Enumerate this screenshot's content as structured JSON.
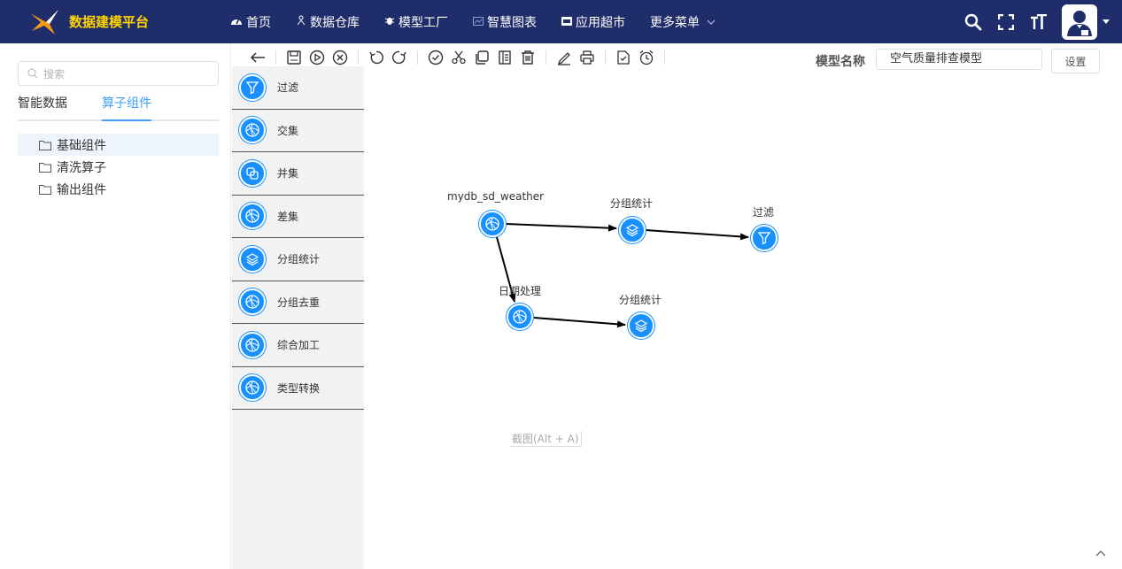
{
  "app": {
    "title": "数据建模平台"
  },
  "nav": [
    {
      "icon": "dashboard-icon",
      "label": "首页"
    },
    {
      "icon": "user-tree-icon",
      "label": "数据仓库"
    },
    {
      "icon": "bug-icon",
      "label": "模型工厂"
    },
    {
      "icon": "chart-card-icon",
      "label": "智慧图表"
    },
    {
      "icon": "store-icon",
      "label": "应用超市"
    },
    {
      "icon": "",
      "label": "更多菜单"
    }
  ],
  "left": {
    "search_placeholder": "搜索",
    "tabs": [
      {
        "label": "智能数据"
      },
      {
        "label": "算子组件",
        "active": true
      }
    ],
    "tree": [
      {
        "label": "基础组件",
        "selected": true
      },
      {
        "label": "清洗算子"
      },
      {
        "label": "输出组件"
      }
    ]
  },
  "toolbar": {
    "model_name_label": "模型名称",
    "model_name_value": "空气质量排查模型",
    "settings_label": "设置",
    "buttons": [
      "back-arrow-icon",
      "save-icon",
      "play-icon",
      "stop-icon",
      "undo-icon",
      "redo-icon",
      "check-icon",
      "cut-icon",
      "copy-icon",
      "document-icon",
      "delete-icon",
      "edit-icon",
      "print-icon",
      "export-icon",
      "alarm-icon"
    ]
  },
  "palette": [
    {
      "icon": "filter-icon",
      "label": "过滤"
    },
    {
      "icon": "globe-icon",
      "label": "交集"
    },
    {
      "icon": "union-icon",
      "label": "并集"
    },
    {
      "icon": "globe-icon",
      "label": "差集"
    },
    {
      "icon": "layers-icon",
      "label": "分组统计"
    },
    {
      "icon": "globe-icon",
      "label": "分组去重"
    },
    {
      "icon": "globe-icon",
      "label": "综合加工"
    },
    {
      "icon": "globe-icon",
      "label": "类型转换"
    }
  ],
  "canvas": {
    "nodes": [
      {
        "id": "n1",
        "label": "mydb_sd_weather",
        "icon": "globe-icon"
      },
      {
        "id": "n2",
        "label": "分组统计",
        "icon": "layers-icon"
      },
      {
        "id": "n3",
        "label": "过滤",
        "icon": "filter-icon"
      },
      {
        "id": "n4",
        "label": "日期处理",
        "icon": "globe-icon"
      },
      {
        "id": "n5",
        "label": "分组统计",
        "icon": "layers-icon"
      }
    ],
    "edges": [
      [
        "n1",
        "n2"
      ],
      [
        "n2",
        "n3"
      ],
      [
        "n1",
        "n4"
      ],
      [
        "n4",
        "n5"
      ]
    ],
    "hint": "截图(Alt + A)"
  },
  "colors": {
    "topbar": "#1f2d6b",
    "accent": "#1890ff",
    "title": "#ffd400"
  }
}
